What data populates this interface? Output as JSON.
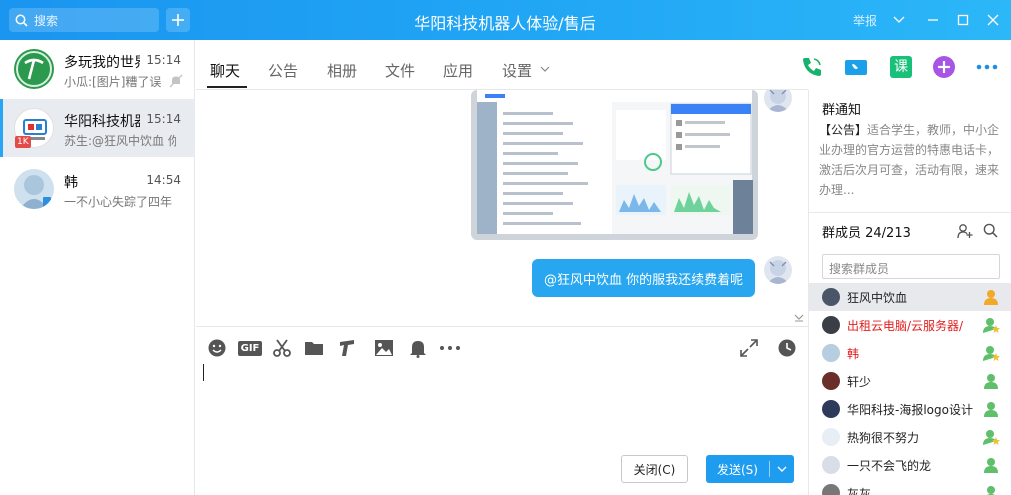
{
  "window": {
    "title": "华阳科技机器人体验/售后",
    "report_label": "举报"
  },
  "search": {
    "placeholder": "搜索"
  },
  "conversations": [
    {
      "name": "多玩我的世界",
      "time": "15:14",
      "preview": "小瓜:[图片]糟了误"
    },
    {
      "name": "华阳科技机器人体验",
      "time": "15:14",
      "preview": "苏生:@狂风中饮血 你"
    },
    {
      "name": "韩",
      "time": "14:54",
      "preview": "一不小心失踪了四年（"
    }
  ],
  "conversation_badge": "1K",
  "tabs": [
    {
      "label": "聊天"
    },
    {
      "label": "公告"
    },
    {
      "label": "相册"
    },
    {
      "label": "文件"
    },
    {
      "label": "应用"
    },
    {
      "label": "设置"
    }
  ],
  "tool_icons": {
    "course_label": "课"
  },
  "chat": {
    "message_text": "@狂风中饮血 你的服我还续费着呢"
  },
  "input_toolbar": {
    "gif_label": "GIF"
  },
  "buttons": {
    "close": "关闭(C)",
    "send": "发送(S)"
  },
  "notice": {
    "title": "群通知",
    "tag": "【公告】",
    "body": "适合学生，教师，中小企业办理的官方运营的特惠电话卡，激活后次月可查，活动有限，速来办理..."
  },
  "members": {
    "title": "群成员 24/213",
    "search_placeholder": "搜索群成员",
    "list": [
      {
        "name": "狂风中饮血"
      },
      {
        "name": "出租云电脑/云服务器/"
      },
      {
        "name": "韩"
      },
      {
        "name": "轩少"
      },
      {
        "name": "华阳科技-海报logo设计"
      },
      {
        "name": "热狗很不努力"
      },
      {
        "name": "一只不会飞的龙"
      },
      {
        "name": "灰灰"
      }
    ]
  },
  "colors": {
    "accent": "#1e9cf0",
    "topbar": "#22a8f5",
    "member_red": "#e02020"
  }
}
